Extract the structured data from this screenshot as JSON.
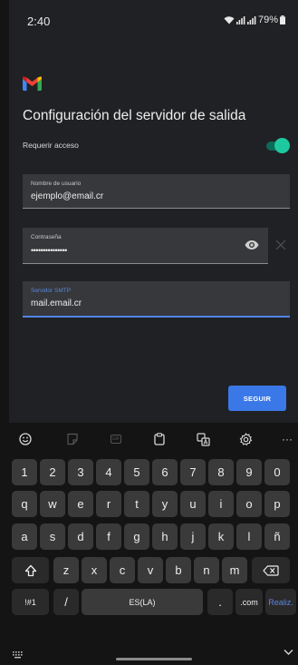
{
  "status_bar": {
    "time": "2:40",
    "battery": "79%"
  },
  "screen": {
    "title": "Configuración del servidor de salida",
    "auth_toggle": {
      "label": "Requerir acceso",
      "on": true
    },
    "username_field": {
      "label": "Nombre de usuario",
      "value": "ejemplo@email.cr"
    },
    "password_field": {
      "label": "Contraseña",
      "value": "•••••••••••••••"
    },
    "server_field": {
      "label": "Servidor SMTP",
      "value": "mail.email.cr"
    },
    "next_button": "SEGUIR"
  },
  "keyboard": {
    "toolbar": [
      "emoji-icon",
      "sticker-icon",
      "gif-icon",
      "clipboard-icon",
      "translate-icon",
      "settings-icon",
      "more-icon"
    ],
    "gif_label": "GIF",
    "more_label": "···",
    "row_numbers": [
      "1",
      "2",
      "3",
      "4",
      "5",
      "6",
      "7",
      "8",
      "9",
      "0"
    ],
    "row_1": [
      "q",
      "w",
      "e",
      "r",
      "t",
      "y",
      "u",
      "i",
      "o",
      "p"
    ],
    "row_2": [
      "a",
      "s",
      "d",
      "f",
      "g",
      "h",
      "j",
      "k",
      "l",
      "ñ"
    ],
    "row_3": [
      "z",
      "x",
      "c",
      "v",
      "b",
      "n",
      "m"
    ],
    "symbols_key": "!#1",
    "slash_key": "/",
    "space_label": "ES(LA)",
    "period_key": ".",
    "dotcom_key": ".com",
    "action_key": "Realiz."
  },
  "colors": {
    "background": "#202124",
    "accent_blue": "#3b78e7",
    "toggle_on": "#1ec9a0"
  }
}
